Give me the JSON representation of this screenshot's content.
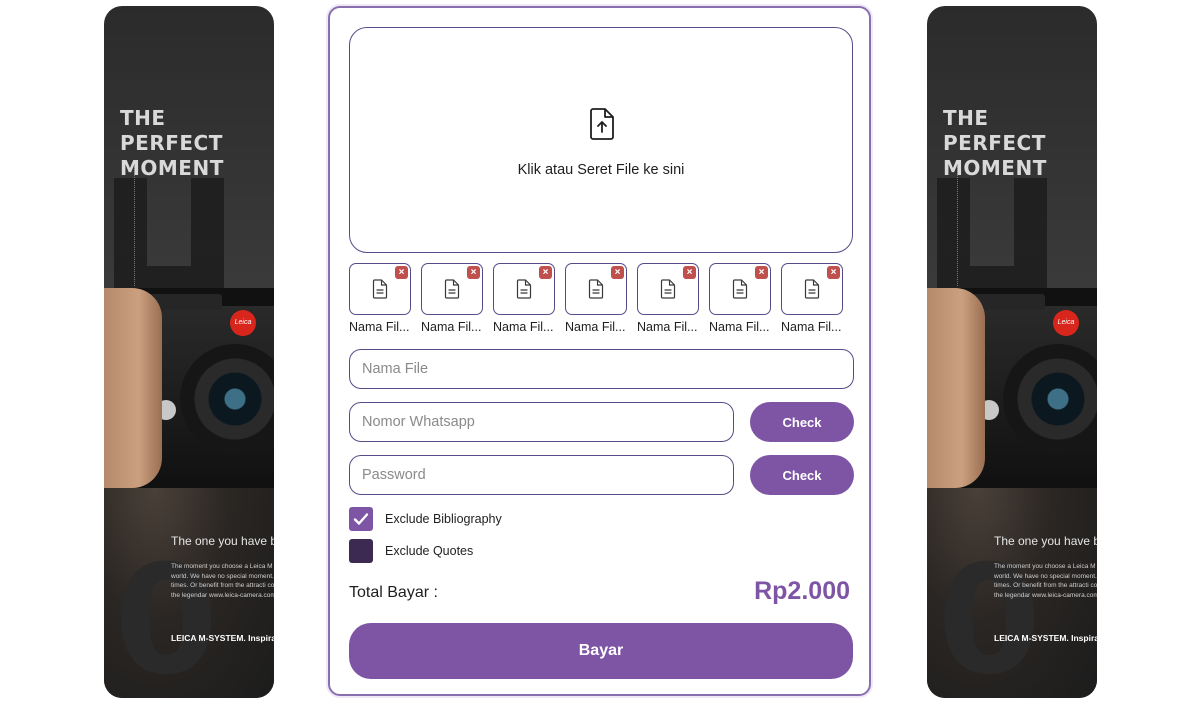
{
  "ads": {
    "headline_line1": "THE PERFECT",
    "headline_line2": "MOMENT",
    "camera_logo": "Leica",
    "tagline": "The one you have b",
    "body": "The moment you choose a Leica M standing of the world. We have no special moment. Choose the 'new li times. Or benefit from the attracti complete with one of the legendar www.leica-camera.com now or con",
    "brand_line": "LEICA M-SYSTEM. Inspirat"
  },
  "upload": {
    "icon": "file-upload-icon",
    "prompt": "Klik atau Seret File ke sini"
  },
  "files": [
    {
      "name": "Nama Fil..."
    },
    {
      "name": "Nama Fil..."
    },
    {
      "name": "Nama Fil..."
    },
    {
      "name": "Nama Fil..."
    },
    {
      "name": "Nama Fil..."
    },
    {
      "name": "Nama Fil..."
    },
    {
      "name": "Nama Fil..."
    }
  ],
  "form": {
    "file_name_placeholder": "Nama File",
    "whatsapp_placeholder": "Nomor Whatsapp",
    "password_placeholder": "Password",
    "check_label": "Check",
    "exclude_bibliography": "Exclude Bibliography",
    "exclude_bibliography_checked": true,
    "exclude_quotes": "Exclude Quotes",
    "exclude_quotes_checked": false
  },
  "total": {
    "label": "Total Bayar :",
    "value": "Rp2.000"
  },
  "pay_label": "Bayar",
  "colors": {
    "accent": "#7e55a5",
    "border": "#5a4a8a",
    "remove": "#c0504d"
  }
}
